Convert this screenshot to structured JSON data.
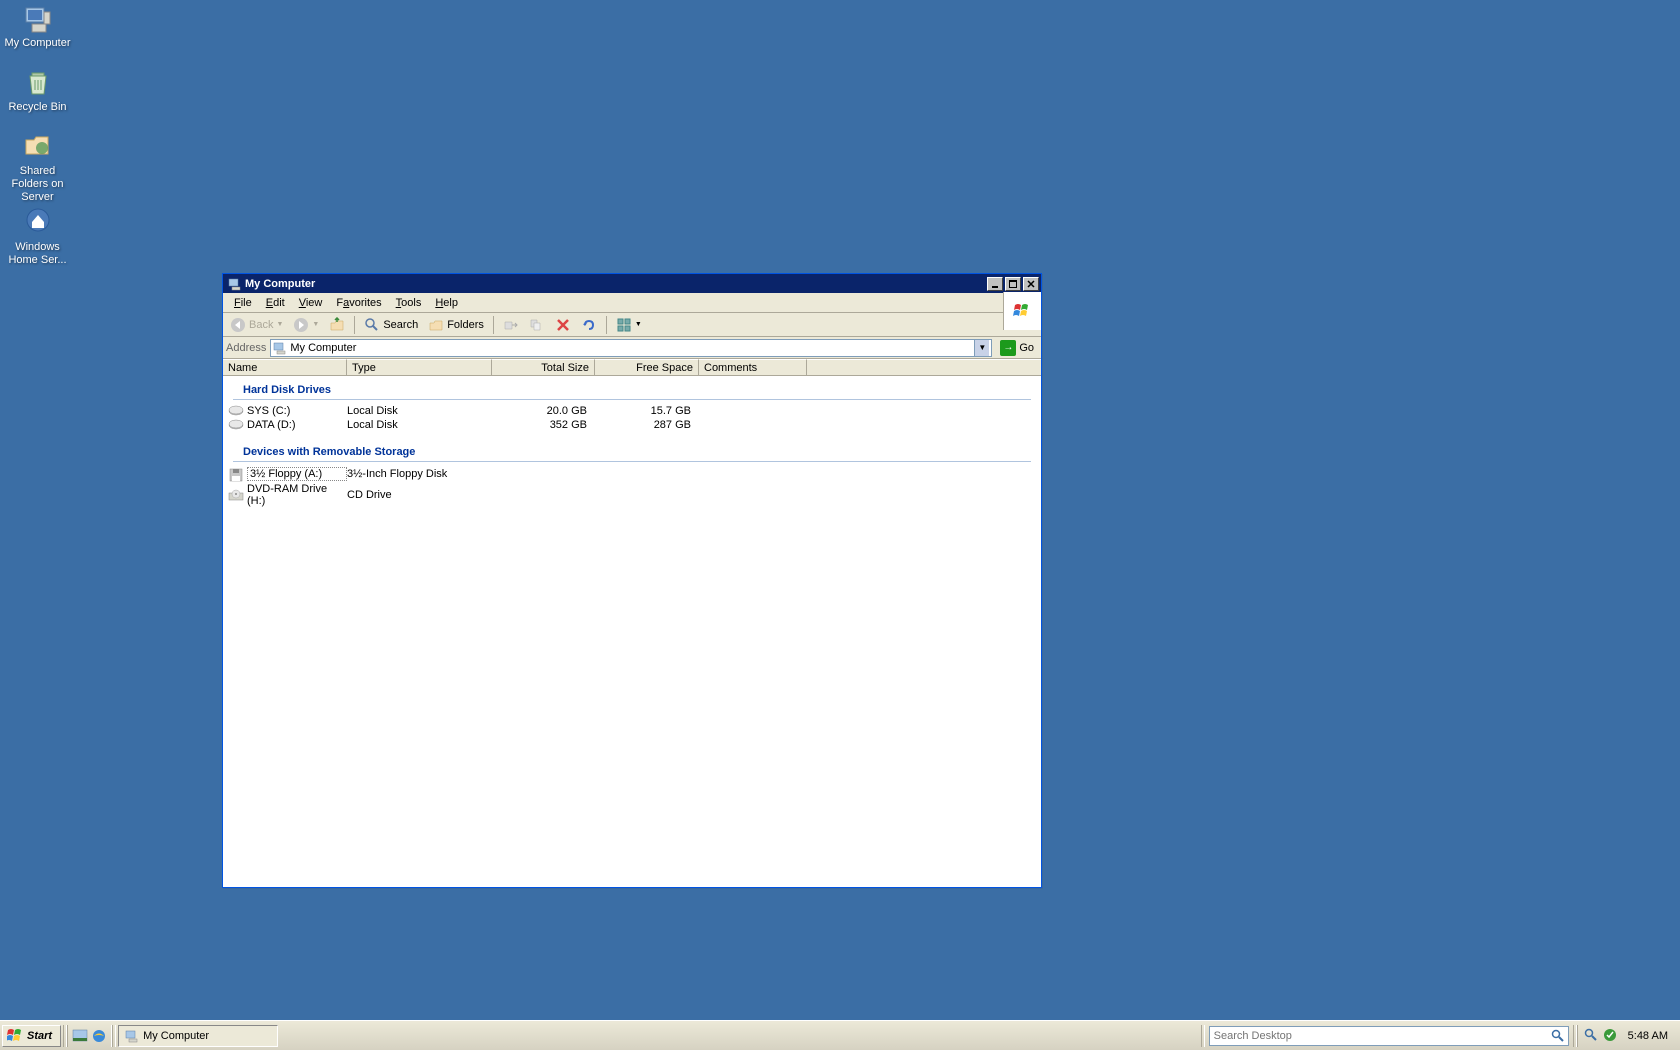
{
  "desktop_icons": [
    {
      "label": "My Computer"
    },
    {
      "label": "Recycle Bin"
    },
    {
      "label": "Shared Folders on Server"
    },
    {
      "label": "Windows Home Ser..."
    }
  ],
  "window": {
    "title": "My Computer",
    "menus": [
      "File",
      "Edit",
      "View",
      "Favorites",
      "Tools",
      "Help"
    ],
    "toolbar": {
      "back": "Back",
      "search": "Search",
      "folders": "Folders"
    },
    "address": {
      "label": "Address",
      "value": "My Computer",
      "go": "Go"
    },
    "columns": [
      "Name",
      "Type",
      "Total Size",
      "Free Space",
      "Comments"
    ],
    "groups": [
      {
        "title": "Hard Disk Drives",
        "items": [
          {
            "name": "SYS (C:)",
            "type": "Local Disk",
            "size": "20.0 GB",
            "free": "15.7 GB"
          },
          {
            "name": "DATA (D:)",
            "type": "Local Disk",
            "size": "352 GB",
            "free": "287 GB"
          }
        ]
      },
      {
        "title": "Devices with Removable Storage",
        "items": [
          {
            "name": "3½ Floppy (A:)",
            "type": "3½-Inch Floppy Disk",
            "size": "",
            "free": "",
            "selected": true
          },
          {
            "name": "DVD-RAM Drive (H:)",
            "type": "CD Drive",
            "size": "",
            "free": ""
          }
        ]
      }
    ]
  },
  "taskbar": {
    "start": "Start",
    "task": "My Computer",
    "search_placeholder": "Search Desktop",
    "clock": "5:48 AM"
  }
}
